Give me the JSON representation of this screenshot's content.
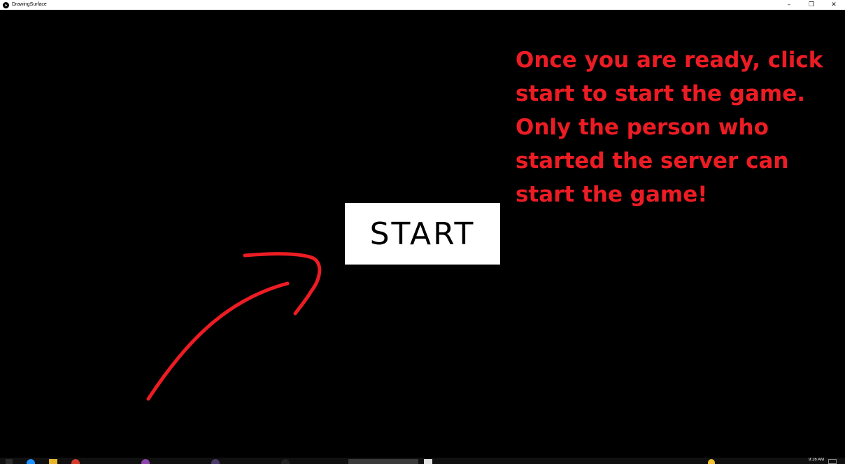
{
  "window": {
    "title": "DrawingSurface",
    "app_icon": "play-circle-icon",
    "controls": {
      "minimize": "–",
      "restore": "❐",
      "close": "✕"
    }
  },
  "main": {
    "start_button_label": "START",
    "instructions_lines": [
      "Once you are ready, click",
      "start to start the game.",
      "Only the person who",
      "started the server can",
      "start the game!"
    ],
    "annotation": "hand-drawn-arrow-icon"
  },
  "colors": {
    "background": "#000000",
    "accent_red": "#ed1c24",
    "button_bg": "#ffffff"
  },
  "taskbar": {
    "clock": "9:16 AM"
  }
}
